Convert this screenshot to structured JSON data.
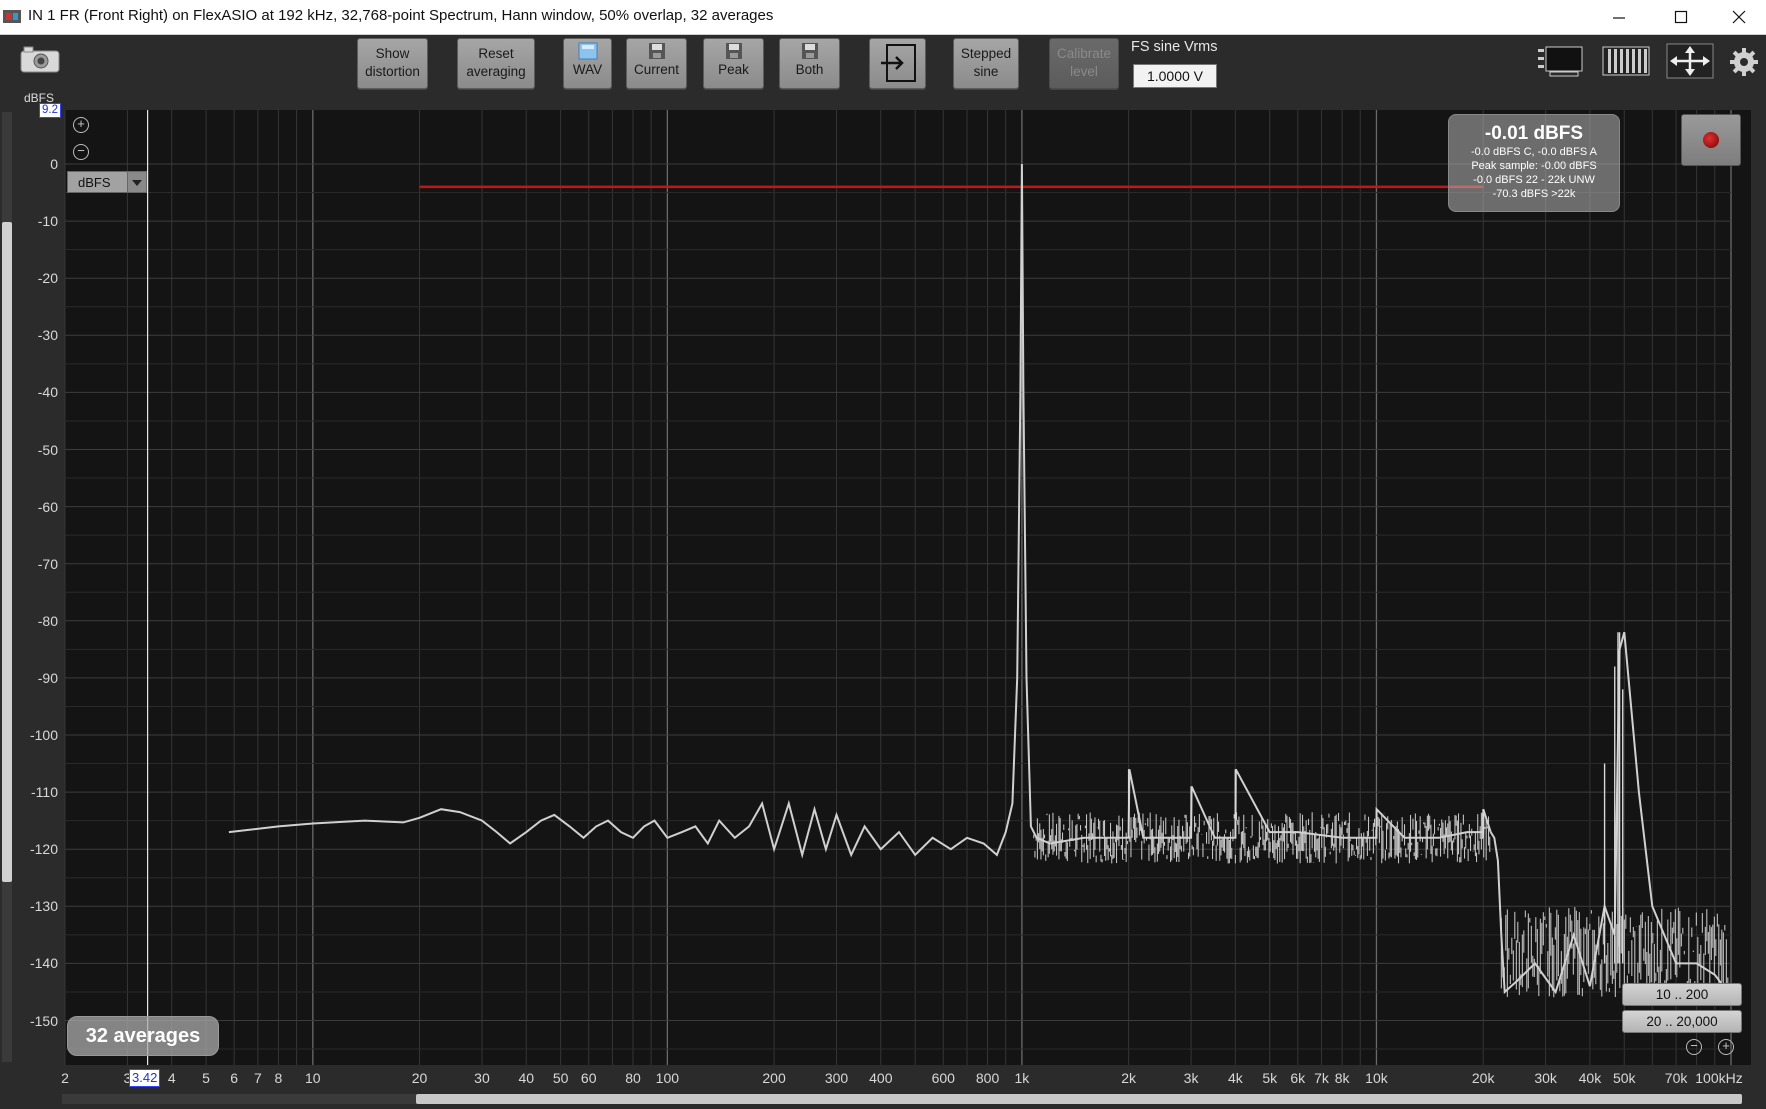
{
  "window": {
    "title": "IN 1 FR (Front Right) on FlexASIO at 192 kHz, 32,768-point Spectrum, Hann window, 50% overlap, 32 averages",
    "controls": [
      "minimize-icon",
      "maximize-icon",
      "close-icon"
    ]
  },
  "toolbar": {
    "show_distortion": "Show distortion",
    "reset_averaging": "Reset averaging",
    "wav": "WAV",
    "current": "Current",
    "peak": "Peak",
    "both": "Both",
    "stepped_sine": "Stepped sine",
    "calibrate_level": "Calibrate level",
    "fs_label": "FS sine Vrms",
    "fs_value": "1.0000 V",
    "icons": [
      "camera-icon",
      "save-icon",
      "import-icon",
      "panel-layout-icon",
      "bar-layout-icon",
      "expand-icon",
      "gear-icon"
    ]
  },
  "plot": {
    "y_unit_label": "dBFS",
    "y_cursor_value": "9.2",
    "unit_select_value": "dBFS",
    "x_cursor_value": "3.42",
    "averages_label": "32 averages",
    "range_buttons": [
      "10 .. 200",
      "20 .. 20,000"
    ],
    "readout": {
      "main": "-0.01 dBFS",
      "lines": [
        "-0.0 dBFS C, -0.0 dBFS A",
        "Peak sample: -0.00 dBFS",
        "-0.0 dBFS 22 - 22k UNW",
        "-70.3 dBFS >22k"
      ]
    },
    "colors": {
      "background": "#141414",
      "trace": "#d0d0d0",
      "peak_line": "#c01818",
      "grid": "#3a3a3a"
    }
  },
  "chart_data": {
    "type": "line",
    "title": "IN 1 FR (Front Right) on FlexASIO at 192 kHz, 32,768-point Spectrum, Hann window, 50% overlap, 32 averages",
    "xlabel": "",
    "ylabel": "dBFS",
    "xscale": "log",
    "xlim": [
      2,
      100000
    ],
    "ylim": [
      -159,
      9.2
    ],
    "x_tick_labels": [
      "2",
      "3",
      "4",
      "5",
      "6",
      "7",
      "8",
      "10",
      "20",
      "30",
      "40",
      "50",
      "60",
      "80",
      "100",
      "200",
      "300",
      "400",
      "600",
      "800",
      "1k",
      "2k",
      "3k",
      "4k",
      "5k",
      "6k",
      "7k",
      "8k",
      "10k",
      "20k",
      "30k",
      "40k",
      "50k",
      "70k",
      "100kHz"
    ],
    "x_tick_values": [
      2,
      3,
      4,
      5,
      6,
      7,
      8,
      10,
      20,
      30,
      40,
      50,
      60,
      80,
      100,
      200,
      300,
      400,
      600,
      800,
      1000,
      2000,
      3000,
      4000,
      5000,
      6000,
      7000,
      8000,
      10000,
      20000,
      30000,
      40000,
      50000,
      70000,
      100000
    ],
    "y_tick_labels": [
      "0",
      "-10",
      "-20",
      "-30",
      "-40",
      "-50",
      "-60",
      "-70",
      "-80",
      "-90",
      "-100",
      "-110",
      "-120",
      "-130",
      "-140",
      "-150"
    ],
    "y_tick_values": [
      0,
      -10,
      -20,
      -30,
      -40,
      -50,
      -60,
      -70,
      -80,
      -90,
      -100,
      -110,
      -120,
      -130,
      -140,
      -150
    ],
    "grid": true,
    "series": [
      {
        "values_x": [
          5.8,
          8,
          10,
          14,
          18,
          20,
          23,
          26,
          30,
          33,
          36,
          40,
          44,
          48,
          53,
          58,
          63,
          68,
          74,
          80,
          86,
          92,
          100,
          110,
          120,
          130,
          140,
          155,
          170,
          185,
          200,
          220,
          240,
          260,
          280,
          300,
          330,
          360,
          400,
          450,
          500,
          560,
          630,
          700,
          780,
          850,
          900,
          940,
          970,
          990,
          1000,
          1010,
          1030,
          1060,
          1100,
          1200,
          1500,
          1800,
          2000,
          2010,
          2200,
          2600,
          3000,
          3010,
          3500,
          4000,
          4010,
          5000,
          6000,
          8000,
          10000,
          10010,
          12000,
          15000,
          18000,
          20000,
          20010,
          21000,
          21500,
          22000,
          22500,
          23000,
          25000,
          28000,
          32000,
          36000,
          40000,
          44000,
          47000,
          48000,
          48500,
          50000,
          55000,
          60000,
          70000,
          80000,
          90000,
          98000
        ],
        "values_y": [
          -117,
          -116,
          -115.5,
          -115,
          -115.3,
          -114.5,
          -113,
          -113.5,
          -115,
          -117,
          -119,
          -117,
          -115,
          -114,
          -116,
          -118,
          -116,
          -115,
          -117,
          -118,
          -116,
          -115,
          -118,
          -117,
          -116,
          -119,
          -115,
          -118,
          -116,
          -112,
          -120,
          -112,
          -121,
          -113,
          -120,
          -114,
          -121,
          -116,
          -120,
          -117,
          -121,
          -118,
          -120,
          -118,
          -119,
          -121,
          -117,
          -112,
          -90,
          -40,
          0,
          -40,
          -90,
          -116,
          -118,
          -119,
          -118,
          -118,
          -118,
          -106,
          -118,
          -118,
          -118,
          -109,
          -118,
          -118,
          -106,
          -117,
          -117,
          -118,
          -118,
          -113,
          -118,
          -118,
          -117,
          -117,
          -113,
          -117,
          -118,
          -122,
          -135,
          -145,
          -143,
          -140,
          -145,
          -135,
          -144,
          -130,
          -135,
          -100,
          -85,
          -82,
          -110,
          -130,
          -140,
          -140,
          -142,
          -145,
          -147
        ]
      }
    ],
    "peak_hold_line": {
      "x_start": 20,
      "x_end": 20000,
      "y": -4
    }
  }
}
